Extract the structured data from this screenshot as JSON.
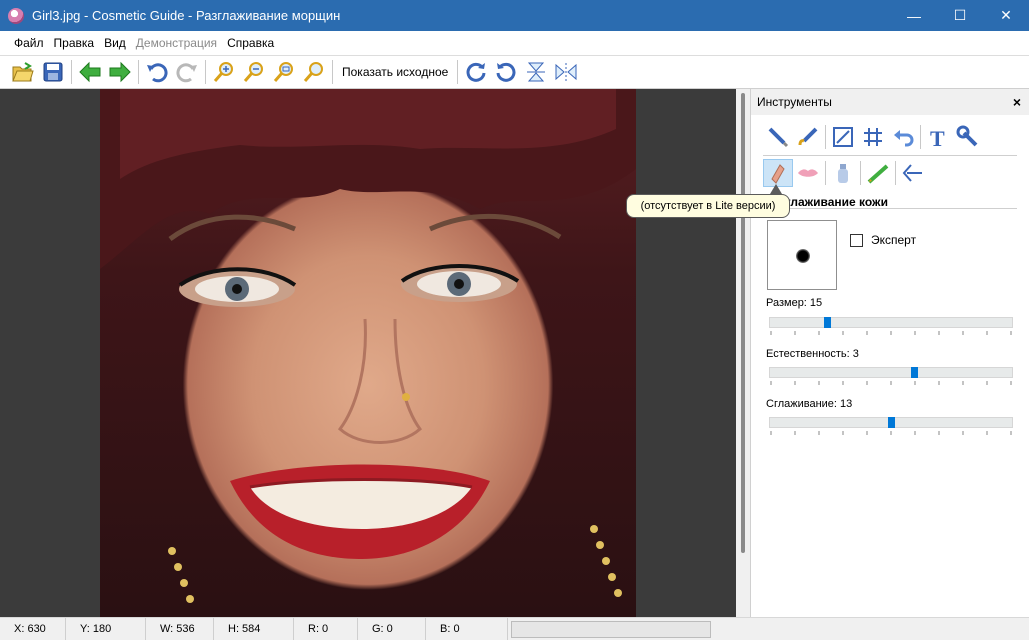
{
  "window": {
    "title": "Girl3.jpg - Cosmetic Guide - Разглаживание морщин",
    "minimize": "—",
    "maximize": "☐",
    "close": "✕"
  },
  "menu": {
    "items": [
      "Файл",
      "Правка",
      "Вид",
      "Демонстрация",
      "Справка"
    ],
    "disabled_item": "Демонстрация"
  },
  "toolbar": {
    "show_original_label": "Показать исходное",
    "icons": [
      "open-icon",
      "save-icon",
      "back-arrow-icon",
      "forward-arrow-icon",
      "undo-icon",
      "redo-icon",
      "zoom-in-icon",
      "zoom-out-icon",
      "zoom-fit-icon",
      "zoom-actual-icon",
      "rotate-right-icon",
      "rotate-left-icon",
      "flip-vertical-icon",
      "flip-horizontal-icon"
    ]
  },
  "panel": {
    "title": "Инструменты",
    "close": "×",
    "section_title": "Разглаживание кожи",
    "expert_label": "Эксперт",
    "tooltip": "(отсутствует в Lite версии)",
    "sliders": [
      {
        "label": "Размер: 15",
        "value": 15,
        "fraction": 0.23
      },
      {
        "label": "Естественность: 3",
        "value": 3,
        "fraction": 0.6
      },
      {
        "label": "Сглаживание: 13",
        "value": 13,
        "fraction": 0.5
      }
    ]
  },
  "status": {
    "x": "X: 630",
    "y": "Y: 180",
    "w": "W: 536",
    "h": "H: 584",
    "r": "R: 0",
    "g": "G: 0",
    "b": "B: 0"
  },
  "colors": {
    "titlebar": "#2b6cb0",
    "accent": "#0078d7",
    "canvas_bg": "#3b3b3b"
  }
}
